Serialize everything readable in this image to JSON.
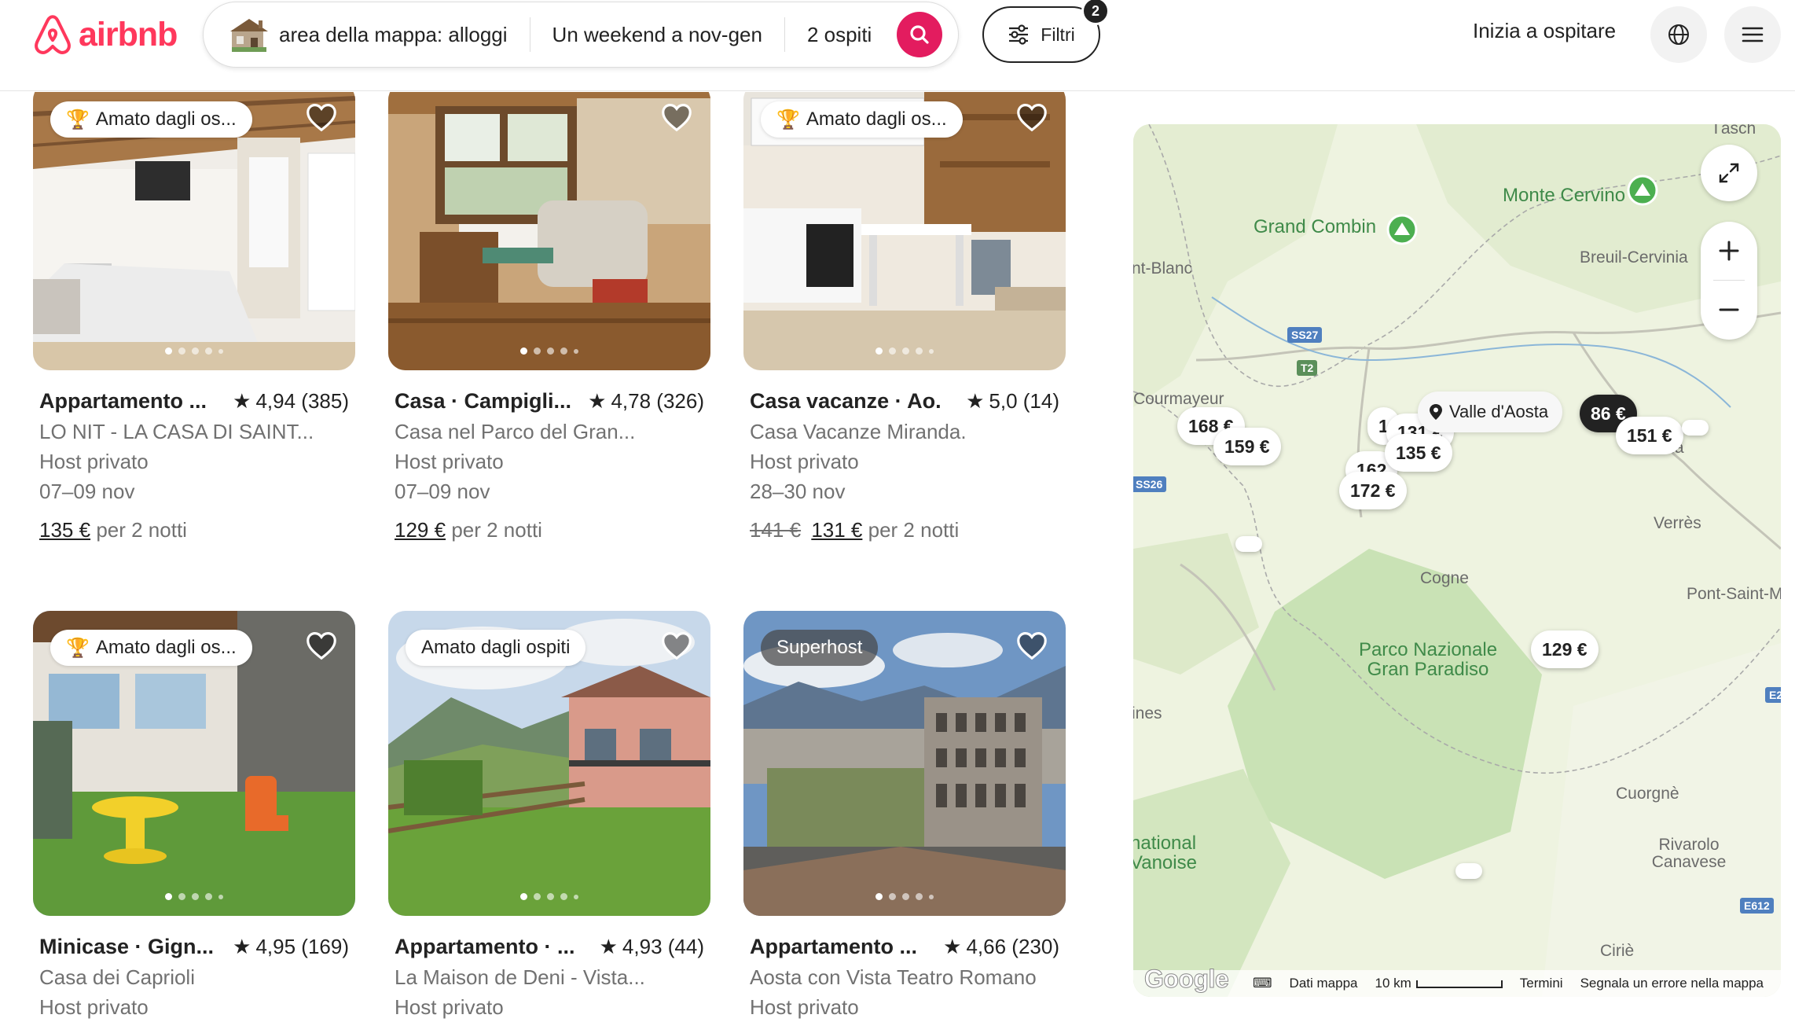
{
  "header": {
    "logo_text": "airbnb",
    "search": {
      "location": "area della mappa: alloggi",
      "dates": "Un weekend a nov-gen",
      "guests": "2 ospiti"
    },
    "filters": {
      "label": "Filtri",
      "count": "2"
    },
    "host_link": "Inizia a ospitare"
  },
  "listings": [
    {
      "badge": "Amato dagli os...",
      "badge_type": "guest-favorite",
      "title": "Appartamento ...",
      "rating": "4,94 (385)",
      "name": "LO NIT - LA CASA DI SAINT...",
      "host": "Host privato",
      "dates": "07–09 nov",
      "price_old": "",
      "price": "135 €",
      "price_suffix": "per 2 notti"
    },
    {
      "badge": "",
      "badge_type": "",
      "title": "Casa · Campigli...",
      "rating": "4,78 (326)",
      "name": "Casa nel Parco del Gran...",
      "host": "Host privato",
      "dates": "07–09 nov",
      "price_old": "",
      "price": "129 €",
      "price_suffix": "per 2 notti"
    },
    {
      "badge": "Amato dagli os...",
      "badge_type": "guest-favorite",
      "title": "Casa vacanze · Ao...",
      "rating": "5,0 (14)",
      "name": "Casa Vacanze Miranda.",
      "host": "Host privato",
      "dates": "28–30 nov",
      "price_old": "141 €",
      "price": "131 €",
      "price_suffix": "per 2 notti"
    },
    {
      "badge": "Amato dagli os...",
      "badge_type": "guest-favorite",
      "title": "Minicase · Gign...",
      "rating": "4,95 (169)",
      "name": "Casa dei Caprioli",
      "host": "Host privato",
      "dates": "",
      "price_old": "",
      "price": "",
      "price_suffix": ""
    },
    {
      "badge": "Amato dagli ospiti",
      "badge_type": "guest-favorite-plain",
      "title": "Appartamento · ...",
      "rating": "4,93 (44)",
      "name": "La Maison de Deni - Vista...",
      "host": "Host privato",
      "dates": "",
      "price_old": "",
      "price": "",
      "price_suffix": ""
    },
    {
      "badge": "Superhost",
      "badge_type": "superhost",
      "title": "Appartamento ...",
      "rating": "4,66 (230)",
      "name": "Aosta con Vista Teatro Romano",
      "host": "Host privato",
      "dates": "",
      "price_old": "",
      "price": "",
      "price_suffix": ""
    }
  ],
  "map": {
    "labels": {
      "monte_cervino": "Monte Cervino",
      "grand_combin": "Grand Combin",
      "breuil": "Breuil-Cervinia",
      "montblanc": "nt-Blanc",
      "courmayeur": "Courmayeur",
      "verres": "Verrès",
      "cogne": "Cogne",
      "pont": "Pont-Saint-M",
      "parco": "Parco Nazionale Gran Paradiso",
      "nes": "ines",
      "cuorgne": "Cuorgnè",
      "vanoise": "national Vanoise",
      "rivarolo": "Rivarolo Canavese",
      "cirie": "Ciriè",
      "tasch": "Täsch",
      "cha": "Cha"
    },
    "roads": {
      "ss27": "SS27",
      "t2": "T2",
      "ss26": "SS26",
      "e2": "E2",
      "e612": "E612"
    },
    "tooltip": "Valle d'Aosta",
    "pins": {
      "p168": "168 €",
      "p159": "159 €",
      "p1a": "1",
      "p131": "131 €",
      "p135": "135 €",
      "p162": "162",
      "p172": "172 €",
      "p86": "86 €",
      "p151": "151 €",
      "p129": "129 €"
    },
    "footer": {
      "keyboard": "⌨",
      "data": "Dati mappa",
      "scale": "10 km",
      "terms": "Termini",
      "report": "Segnala un errore nella mappa"
    },
    "google": "Google"
  },
  "colors": {
    "brand": "#ff385c",
    "search_button": "#e31c5f",
    "map_land": "#e8f0d6",
    "map_park": "#c9e2b5"
  }
}
